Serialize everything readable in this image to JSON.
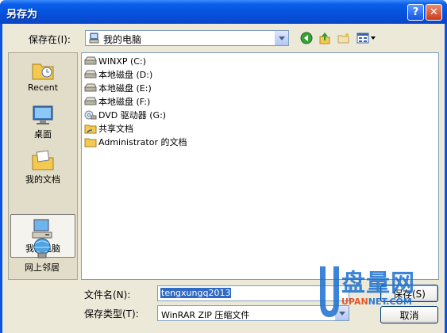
{
  "window": {
    "title": "另存为"
  },
  "titlebar": {
    "help_glyph": "?",
    "close_glyph": "✕"
  },
  "savein": {
    "label": "保存在(I):",
    "value": "我的电脑",
    "icon": "my-computer-icon"
  },
  "toolbar": {
    "icons": [
      "back-icon",
      "up-folder-icon",
      "new-folder-icon",
      "views-menu-icon"
    ]
  },
  "places": [
    {
      "label": "Recent",
      "icon": "recent-folder-icon",
      "selected": false
    },
    {
      "label": "桌面",
      "icon": "desktop-icon",
      "selected": false
    },
    {
      "label": "我的文档",
      "icon": "my-documents-icon",
      "selected": false
    },
    {
      "label": "我的电脑",
      "icon": "my-computer-icon",
      "selected": true
    },
    {
      "label": "网上邻居",
      "icon": "network-places-icon",
      "selected": false
    }
  ],
  "files": [
    {
      "label": "WINXP (C:)",
      "icon": "drive-icon"
    },
    {
      "label": "本地磁盘 (D:)",
      "icon": "drive-icon"
    },
    {
      "label": "本地磁盘 (E:)",
      "icon": "drive-icon"
    },
    {
      "label": "本地磁盘 (F:)",
      "icon": "drive-icon"
    },
    {
      "label": "DVD 驱动器 (G:)",
      "icon": "dvd-drive-icon"
    },
    {
      "label": "共享文档",
      "icon": "shared-folder-icon"
    },
    {
      "label": "Administrator 的文档",
      "icon": "folder-icon"
    }
  ],
  "filename": {
    "label": "文件名(N):",
    "value": "tengxungq2013"
  },
  "filetype": {
    "label": "保存类型(T):",
    "value": "WinRAR ZIP 压缩文件"
  },
  "buttons": {
    "save": "保存(S)",
    "cancel": "取消"
  },
  "watermark": {
    "cn": "盘量网",
    "url_a": "UPAN",
    "url_b": "NET.COM"
  },
  "colors": {
    "titlebar": "#0552de",
    "face": "#ece9d8",
    "selection": "#316ac5",
    "border": "#7f9db9"
  }
}
